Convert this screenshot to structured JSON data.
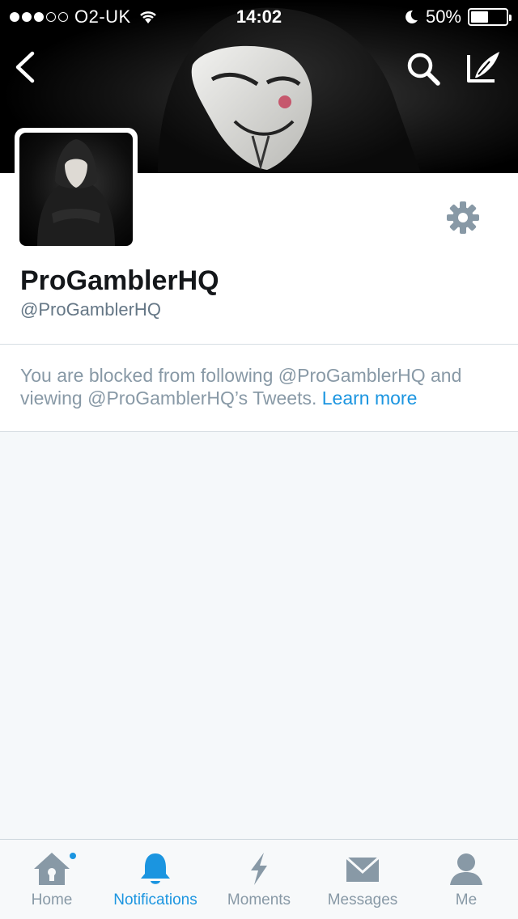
{
  "status_bar": {
    "carrier": "O2-UK",
    "time": "14:02",
    "battery": "50%",
    "battery_level": 0.5,
    "signal_bars_filled": 3,
    "signal_bars_total": 5
  },
  "header": {
    "back_icon": "chevron-left-icon",
    "search_icon": "search-icon",
    "compose_icon": "compose-tweet-icon"
  },
  "profile": {
    "display_name": "ProGamblerHQ",
    "screen_name": "@ProGamblerHQ",
    "settings_icon": "gear-icon"
  },
  "blocked_notice": {
    "text": "You are blocked from following @ProGamblerHQ and viewing @ProGamblerHQ’s Tweets.",
    "link": "Learn more"
  },
  "tab_bar": {
    "tabs": [
      {
        "label": "Home",
        "icon": "home-icon",
        "active": false,
        "has_dot": true
      },
      {
        "label": "Notifications",
        "icon": "bell-icon",
        "active": true,
        "has_dot": false
      },
      {
        "label": "Moments",
        "icon": "lightning-icon",
        "active": false,
        "has_dot": false
      },
      {
        "label": "Messages",
        "icon": "envelope-icon",
        "active": false,
        "has_dot": false
      },
      {
        "label": "Me",
        "icon": "person-icon",
        "active": false,
        "has_dot": false
      }
    ]
  },
  "colors": {
    "accent": "#1b95e0",
    "muted": "#8899a6",
    "text": "#14171a",
    "background": "#f5f8fa"
  }
}
